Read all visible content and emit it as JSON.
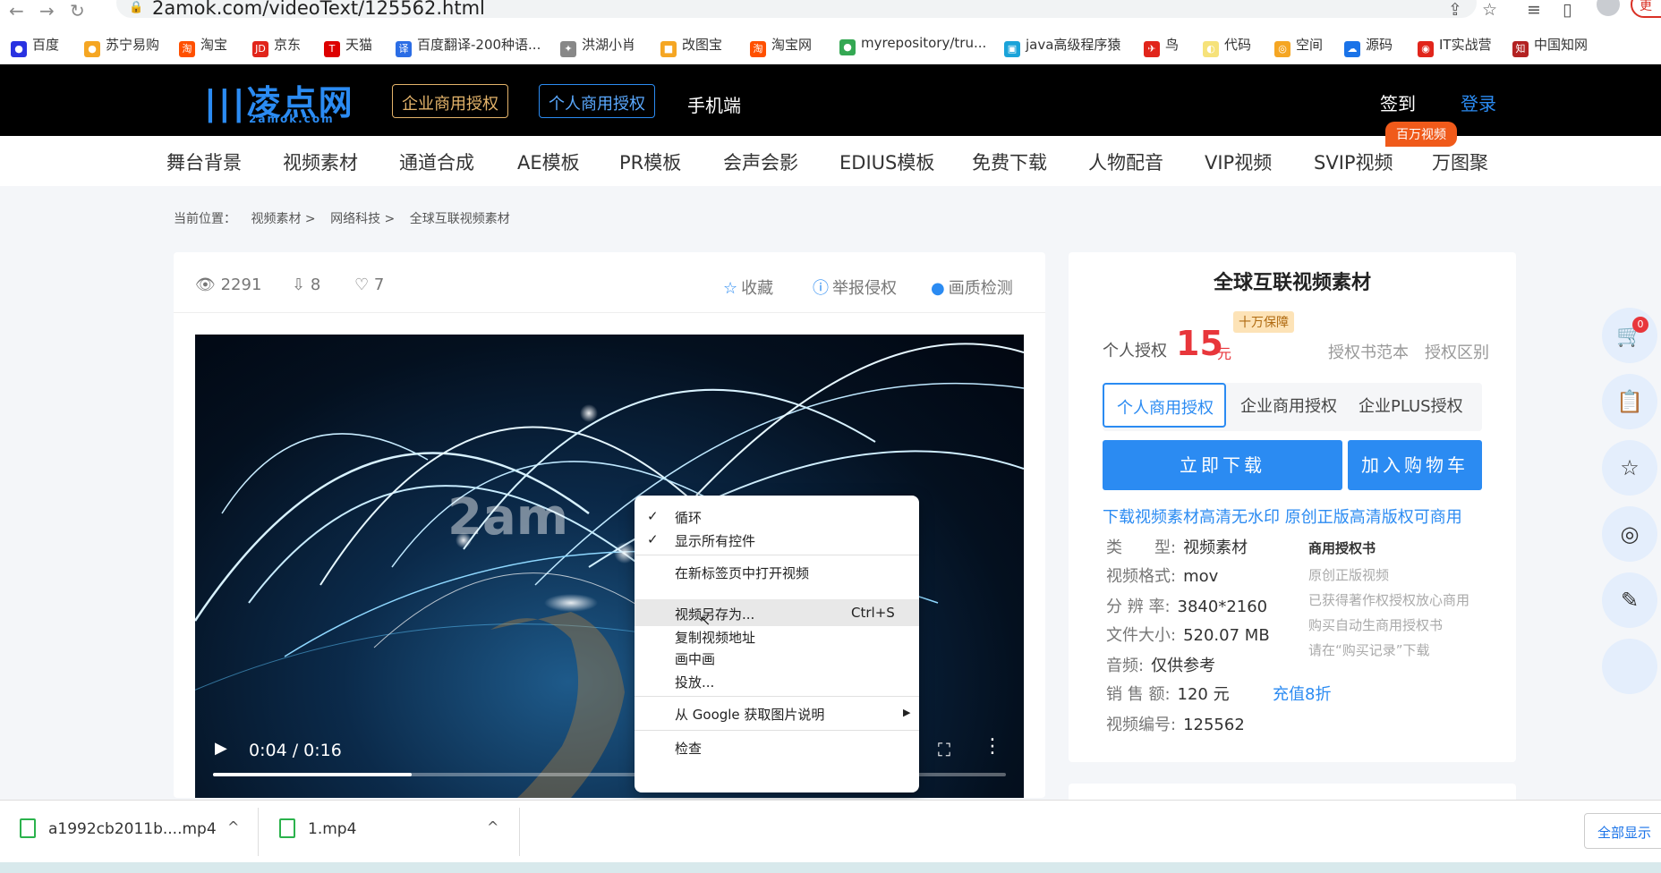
{
  "browser": {
    "url": "2amok.com/videoText/125562.html",
    "update_label": "更"
  },
  "bookmarks": [
    "百度",
    "苏宁易购",
    "淘宝",
    "京东",
    "天猫",
    "百度翻译-200种语...",
    "洪湖小肖",
    "改图宝",
    "淘宝网",
    "myrepository/tru...",
    "java高级程序猿",
    "鸟",
    "代码",
    "空间",
    "源码",
    "IT实战营",
    "中国知网"
  ],
  "header": {
    "logo_main": "凌点网",
    "logo_sub": "2amok.com",
    "btn_enterprise": "企业商用授权",
    "btn_personal": "个人商用授权",
    "mobile": "手机端",
    "signin": "签到",
    "login": "登录"
  },
  "categories": [
    "舞台背景",
    "视频素材",
    "通道合成",
    "AE模板",
    "PR模板",
    "会声会影",
    "EDIUS模板",
    "免费下载",
    "人物配音",
    "VIP视频",
    "SVIP视频",
    "万图聚"
  ],
  "million_badge": "百万视频",
  "breadcrumb": {
    "prefix": "当前位置：",
    "items": [
      "视频素材 >",
      "网络科技 >",
      "全球互联视频素材"
    ]
  },
  "stats": {
    "views": "2291",
    "downloads": "8",
    "likes": "7"
  },
  "actions": {
    "favorite": "收藏",
    "report": "举报侵权",
    "quality": "画质检测"
  },
  "video": {
    "time": "0:04 / 0:16",
    "progress": 0.25,
    "watermark": "2am"
  },
  "context_menu": {
    "loop": "循环",
    "show_controls": "显示所有控件",
    "open_new_tab": "在新标签页中打开视频",
    "save_as": "视频另存为...",
    "save_shortcut": "Ctrl+S",
    "copy_address": "复制视频地址",
    "pip": "画中画",
    "cast": "投放...",
    "google": "从 Google 获取图片说明",
    "inspect": "检查"
  },
  "product": {
    "title": "全球互联视频素材",
    "guarantee": "十万保障",
    "price_label": "个人授权",
    "price": "15",
    "unit": "元",
    "link_sample": "授权书范本",
    "link_diff": "授权区别",
    "tabs": [
      "个人商用授权",
      "企业商用授权",
      "企业PLUS授权"
    ],
    "download": "立即下载",
    "add_cart": "加入购物车",
    "promo": "下载视频素材高清无水印 原创正版高清版权可商用",
    "specs": [
      {
        "label": "类　　型:",
        "value": "视频素材"
      },
      {
        "label": "视频格式:",
        "value": "mov"
      },
      {
        "label": "分 辨 率:",
        "value": "3840*2160"
      },
      {
        "label": "文件大小:",
        "value": "520.07 MB"
      },
      {
        "label": "音频:",
        "value": "仅供参考"
      },
      {
        "label": "销 售 额:",
        "value": "120 元"
      },
      {
        "label": "视频编号:",
        "value": "125562"
      }
    ],
    "license_head": "商用授权书",
    "license_lines": [
      "原创正版视频",
      "已获得著作权授权放心商用",
      "购买自动生商用授权书",
      "请在“购买记录”下载"
    ],
    "recharge": "充值8折"
  },
  "side": {
    "cart_count": "0"
  },
  "downloads": [
    {
      "name": "a1992cb2011b....mp4"
    },
    {
      "name": "1.mp4"
    }
  ],
  "show_all": "全部显示"
}
